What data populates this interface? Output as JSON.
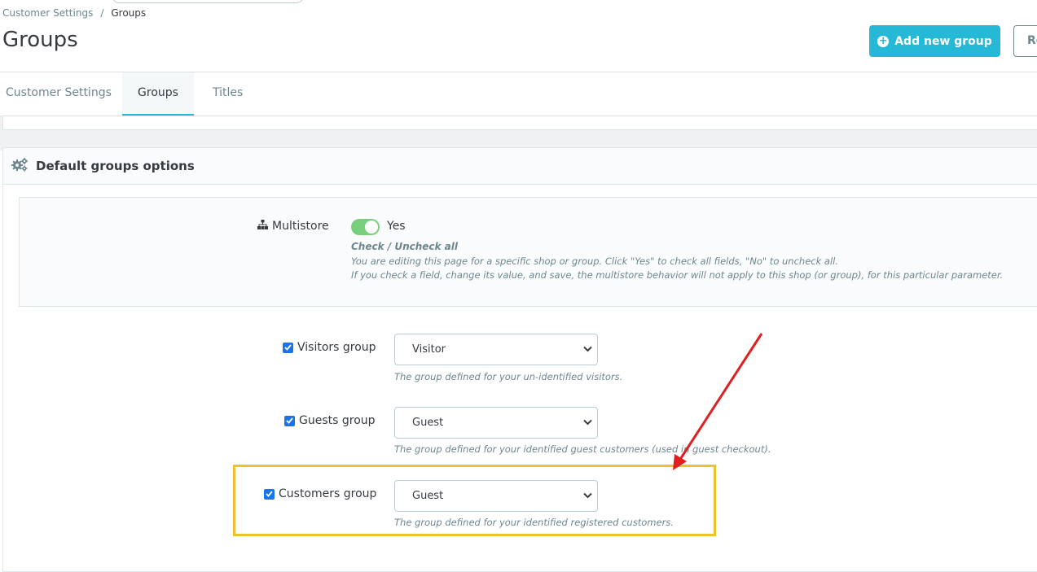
{
  "breadcrumb": {
    "parent": "Customer Settings",
    "separator": "/",
    "current": "Groups"
  },
  "page_title": "Groups",
  "toolbar": {
    "add_label": "Add new group",
    "second_label": "Re"
  },
  "tabs": [
    {
      "label": "Customer Settings",
      "active": false
    },
    {
      "label": "Groups",
      "active": true
    },
    {
      "label": "Titles",
      "active": false
    }
  ],
  "panel": {
    "title": "Default groups options"
  },
  "multistore": {
    "label": "Multistore",
    "value": "Yes",
    "checked": true,
    "help_title": "Check / Uncheck all",
    "help_line1": "You are editing this page for a specific shop or group. Click \"Yes\" to check all fields, \"No\" to uncheck all.",
    "help_line2": "If you check a field, change its value, and save, the multistore behavior will not apply to this shop (or group), for this particular parameter."
  },
  "fields": [
    {
      "label": "Visitors group",
      "checked": true,
      "value": "Visitor",
      "help": "The group defined for your un-identified visitors."
    },
    {
      "label": "Guests group",
      "checked": true,
      "value": "Guest",
      "help": "The group defined for your identified guest customers (used in guest checkout)."
    },
    {
      "label": "Customers group",
      "checked": true,
      "value": "Guest",
      "help": "The group defined for your identified registered customers."
    }
  ],
  "colors": {
    "accent": "#25b9d7",
    "toggle_on": "#78d07d",
    "highlight": "#f0c030",
    "annotation_arrow": "#e02020"
  }
}
